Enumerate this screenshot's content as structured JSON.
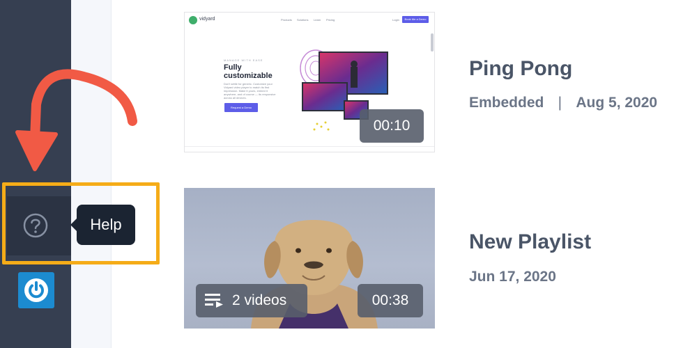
{
  "help": {
    "tooltip": "Help"
  },
  "videos": [
    {
      "title": "Ping Pong",
      "source": "Embedded",
      "separator": "|",
      "date": "Aug 5, 2020",
      "duration": "00:10",
      "thumbnail": {
        "logo": "vidyard",
        "nav": [
          "Products",
          "Solutions",
          "Learn",
          "Pricing",
          "Login"
        ],
        "cta": "Book Me a Demo",
        "kicker": "MANAGE WITH EASE",
        "headline": "Fully customizable",
        "body": "Don't settle for generic. Customize your Vidyard video player to match its first impression. Make it yours, embed it anywhere, and of course — its responsive across all devices.",
        "button": "Request a Demo"
      }
    },
    {
      "title": "New Playlist",
      "date": "Jun 17, 2020",
      "video_count": "2 videos",
      "duration": "00:38"
    }
  ],
  "colors": {
    "sidebar": "#363f51",
    "highlight": "#f5ac18",
    "arrow": "#f15a45",
    "power_button": "#1c8bd0",
    "tooltip": "#1b2432"
  }
}
